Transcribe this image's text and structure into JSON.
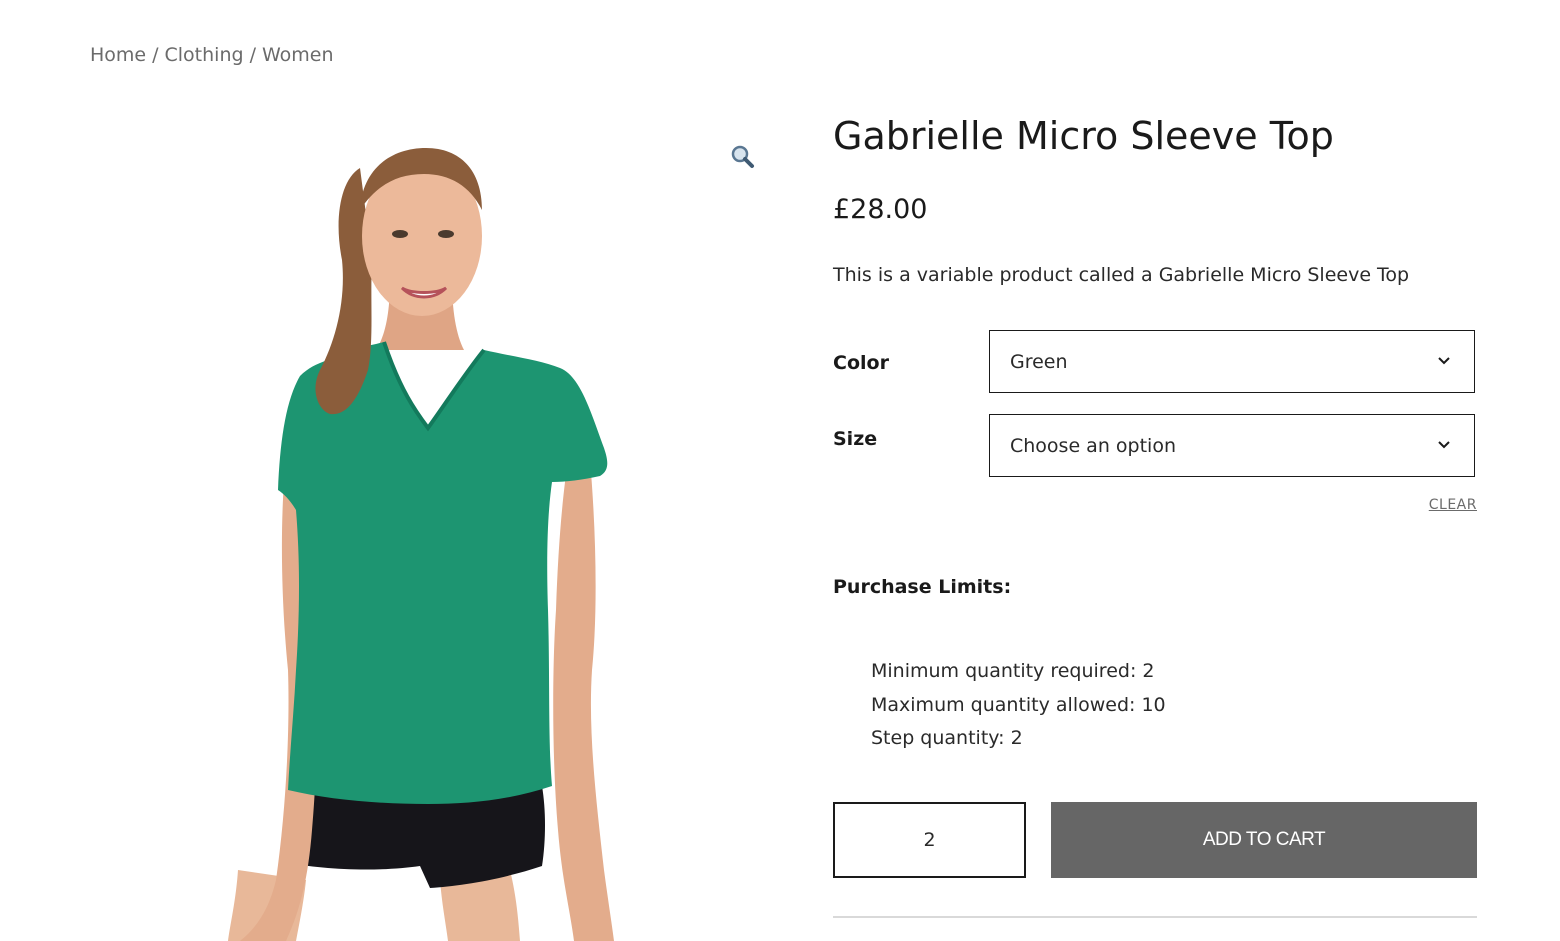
{
  "breadcrumb": {
    "home": "Home",
    "separator": "/",
    "clothing": "Clothing",
    "women": "Women"
  },
  "gallery": {
    "image_subject": "woman-wearing-green-v-neck-tshirt",
    "zoom_icon": "magnifier-icon",
    "tshirt_color": "#1d9571"
  },
  "product": {
    "title": "Gabrielle Micro Sleeve Top",
    "price": "£28.00",
    "description": "This is a variable product called a Gabrielle Micro Sleeve Top"
  },
  "variations": {
    "color": {
      "label": "Color",
      "selected": "Green"
    },
    "size": {
      "label": "Size",
      "selected": "Choose an option"
    },
    "clear_label": "CLEAR"
  },
  "purchase_limits": {
    "heading": "Purchase Limits:",
    "items": [
      "Minimum quantity required: 2",
      "Maximum quantity allowed: 10",
      "Step quantity: 2"
    ]
  },
  "cart": {
    "quantity": "2",
    "add_label": "ADD TO CART",
    "button_color": "#666666"
  }
}
